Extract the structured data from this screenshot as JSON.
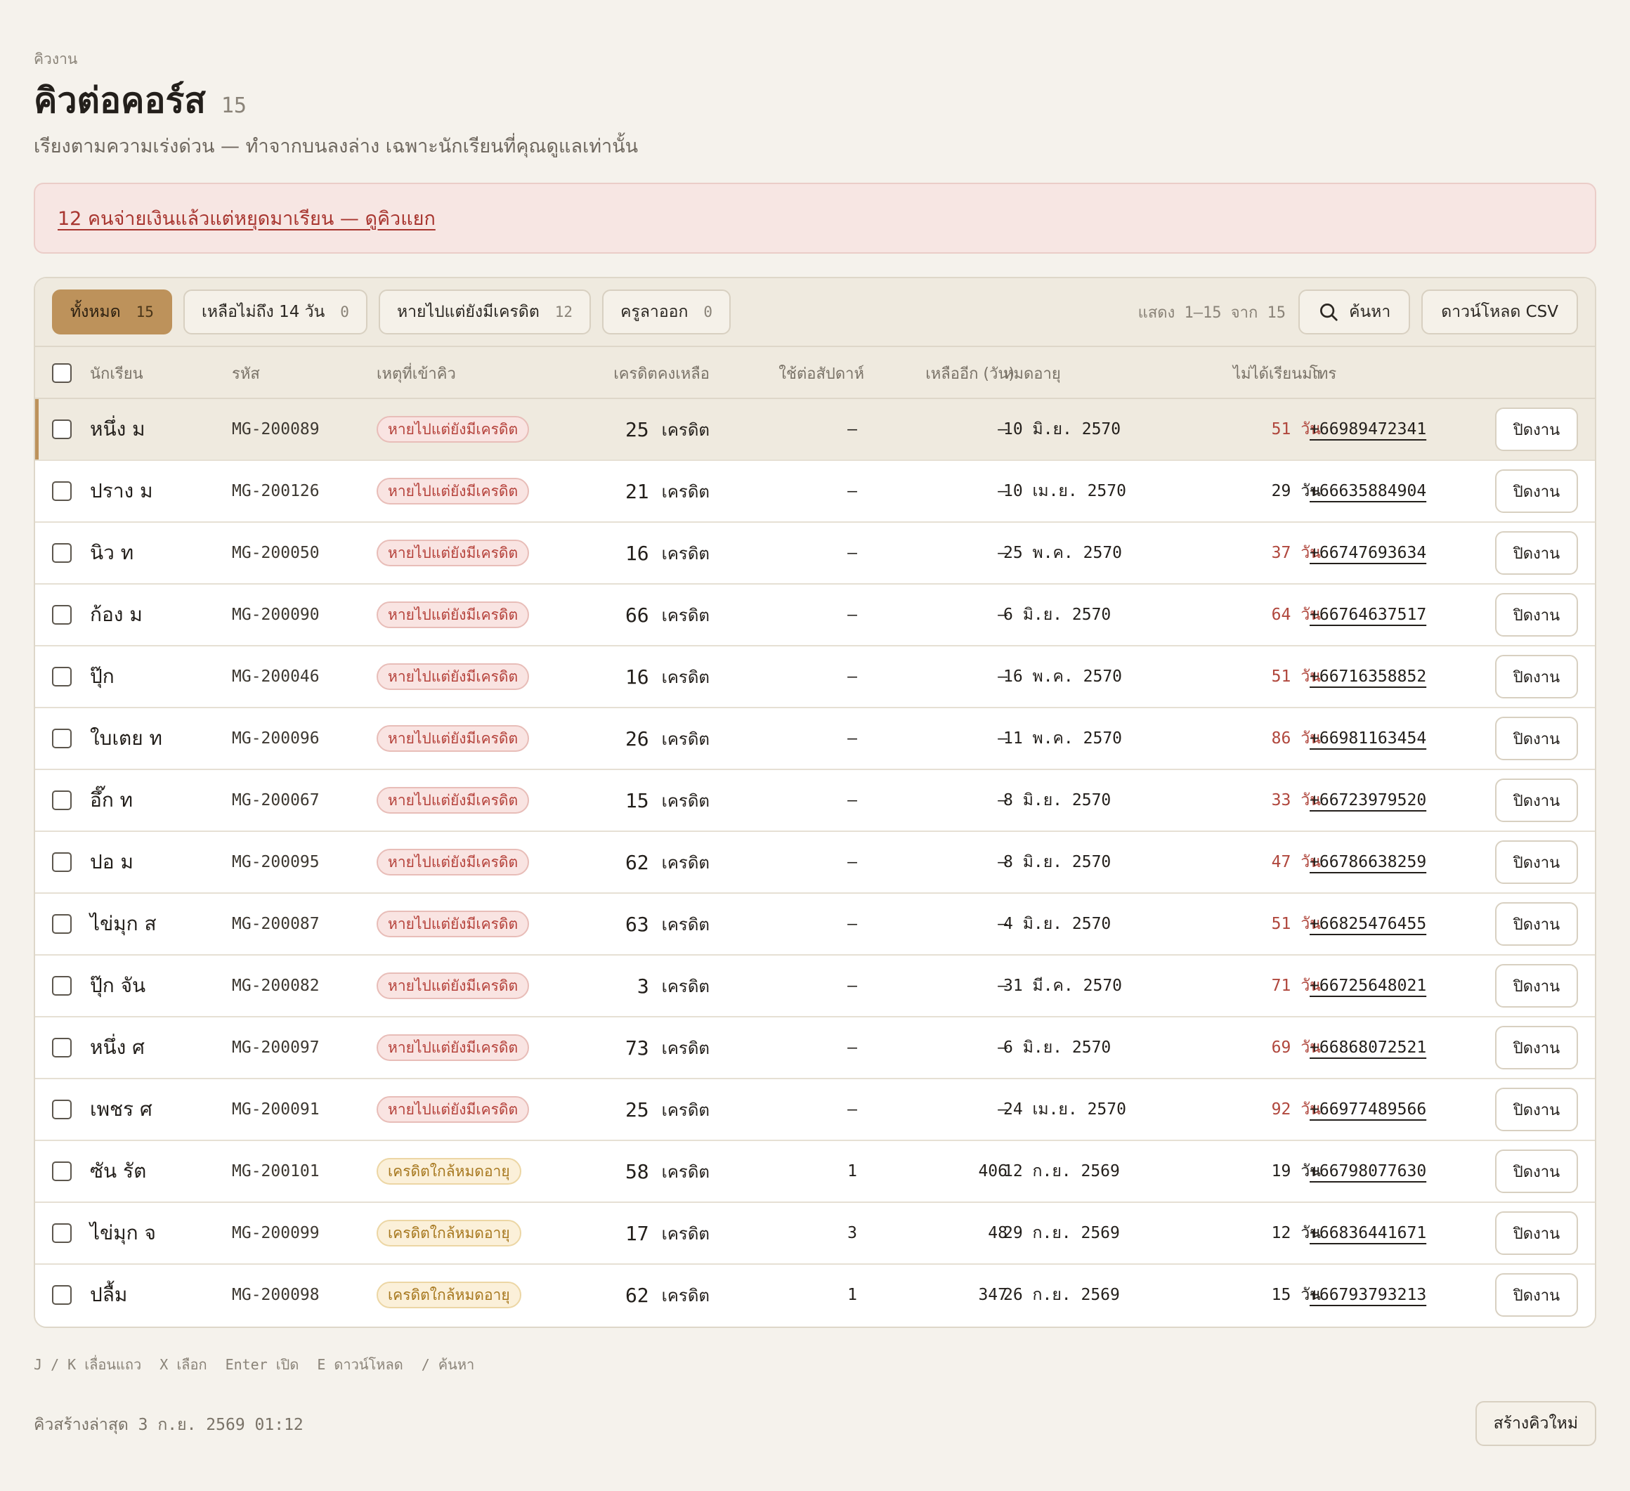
{
  "header": {
    "eyebrow": "คิวงาน",
    "title": "คิวต่อคอร์ส",
    "count": "15",
    "subtitle": "เรียงตามความเร่งด่วน — ทำจากบนลงล่าง เฉพาะนักเรียนที่คุณดูแลเท่านั้น"
  },
  "alert": {
    "text": "12 คนจ่ายเงินแล้วแต่หยุดมาเรียน — ดูคิวแยก"
  },
  "toolbar": {
    "filters": [
      {
        "label": "ทั้งหมด",
        "count": "15"
      },
      {
        "label": "เหลือไม่ถึง 14 วัน",
        "count": "0"
      },
      {
        "label": "หายไปแต่ยังมีเครดิต",
        "count": "12"
      },
      {
        "label": "ครูลาออก",
        "count": "0"
      }
    ],
    "range": "แสดง 1–15 จาก 15",
    "search_label": "ค้นหา",
    "csv_label": "ดาวน์โหลด CSV"
  },
  "columns": {
    "name": "นักเรียน",
    "code": "รหัส",
    "reason": "เหตุที่เข้าคิว",
    "credits": "เครดิตคงเหลือ",
    "weekly": "ใช้ต่อสัปดาห์",
    "days_left": "เหลืออีก (วัน)",
    "expiry": "หมดอายุ",
    "absent": "ไม่ได้เรียนมา",
    "phone": "โทร"
  },
  "labels": {
    "credit_unit": "เครดิต",
    "day_unit": "วัน",
    "close": "ปิดงาน"
  },
  "colors": {
    "accent": "#bd925b",
    "danger": "#b0473d",
    "amber": "#a7781f"
  },
  "rows": [
    {
      "name": "หนึ่ง ม",
      "code": "MG-200089",
      "reason": "หายไปแต่ยังมีเครดิต",
      "tone": "red",
      "credits": "25",
      "weekly": "–",
      "days_left": "–",
      "expiry": "10 มิ.ย. 2570",
      "absent": "51",
      "hot": true,
      "phone": "+66989472341"
    },
    {
      "name": "ปราง ม",
      "code": "MG-200126",
      "reason": "หายไปแต่ยังมีเครดิต",
      "tone": "red",
      "credits": "21",
      "weekly": "–",
      "days_left": "–",
      "expiry": "10 เม.ย. 2570",
      "absent": "29",
      "hot": false,
      "phone": "+66635884904"
    },
    {
      "name": "นิว ท",
      "code": "MG-200050",
      "reason": "หายไปแต่ยังมีเครดิต",
      "tone": "red",
      "credits": "16",
      "weekly": "–",
      "days_left": "–",
      "expiry": "25 พ.ค. 2570",
      "absent": "37",
      "hot": true,
      "phone": "+66747693634"
    },
    {
      "name": "ก้อง ม",
      "code": "MG-200090",
      "reason": "หายไปแต่ยังมีเครดิต",
      "tone": "red",
      "credits": "66",
      "weekly": "–",
      "days_left": "–",
      "expiry": "6 มิ.ย. 2570",
      "absent": "64",
      "hot": true,
      "phone": "+66764637517"
    },
    {
      "name": "ปุ๊ก",
      "code": "MG-200046",
      "reason": "หายไปแต่ยังมีเครดิต",
      "tone": "red",
      "credits": "16",
      "weekly": "–",
      "days_left": "–",
      "expiry": "16 พ.ค. 2570",
      "absent": "51",
      "hot": true,
      "phone": "+66716358852"
    },
    {
      "name": "ใบเตย ท",
      "code": "MG-200096",
      "reason": "หายไปแต่ยังมีเครดิต",
      "tone": "red",
      "credits": "26",
      "weekly": "–",
      "days_left": "–",
      "expiry": "11 พ.ค. 2570",
      "absent": "86",
      "hot": true,
      "phone": "+66981163454"
    },
    {
      "name": "อึ๊ก ท",
      "code": "MG-200067",
      "reason": "หายไปแต่ยังมีเครดิต",
      "tone": "red",
      "credits": "15",
      "weekly": "–",
      "days_left": "–",
      "expiry": "8 มิ.ย. 2570",
      "absent": "33",
      "hot": true,
      "phone": "+66723979520"
    },
    {
      "name": "ปอ ม",
      "code": "MG-200095",
      "reason": "หายไปแต่ยังมีเครดิต",
      "tone": "red",
      "credits": "62",
      "weekly": "–",
      "days_left": "–",
      "expiry": "8 มิ.ย. 2570",
      "absent": "47",
      "hot": true,
      "phone": "+66786638259"
    },
    {
      "name": "ไข่มุก ส",
      "code": "MG-200087",
      "reason": "หายไปแต่ยังมีเครดิต",
      "tone": "red",
      "credits": "63",
      "weekly": "–",
      "days_left": "–",
      "expiry": "4 มิ.ย. 2570",
      "absent": "51",
      "hot": true,
      "phone": "+66825476455"
    },
    {
      "name": "ปุ๊ก จัน",
      "code": "MG-200082",
      "reason": "หายไปแต่ยังมีเครดิต",
      "tone": "red",
      "credits": "3",
      "weekly": "–",
      "days_left": "–",
      "expiry": "31 มี.ค. 2570",
      "absent": "71",
      "hot": true,
      "phone": "+66725648021"
    },
    {
      "name": "หนึ่ง ศ",
      "code": "MG-200097",
      "reason": "หายไปแต่ยังมีเครดิต",
      "tone": "red",
      "credits": "73",
      "weekly": "–",
      "days_left": "–",
      "expiry": "6 มิ.ย. 2570",
      "absent": "69",
      "hot": true,
      "phone": "+66868072521"
    },
    {
      "name": "เพชร ศ",
      "code": "MG-200091",
      "reason": "หายไปแต่ยังมีเครดิต",
      "tone": "red",
      "credits": "25",
      "weekly": "–",
      "days_left": "–",
      "expiry": "24 เม.ย. 2570",
      "absent": "92",
      "hot": true,
      "phone": "+66977489566"
    },
    {
      "name": "ซัน รัต",
      "code": "MG-200101",
      "reason": "เครดิตใกล้หมดอายุ",
      "tone": "amber",
      "credits": "58",
      "weekly": "1",
      "days_left": "406",
      "expiry": "12 ก.ย. 2569",
      "absent": "19",
      "hot": false,
      "phone": "+66798077630"
    },
    {
      "name": "ไข่มุก จ",
      "code": "MG-200099",
      "reason": "เครดิตใกล้หมดอายุ",
      "tone": "amber",
      "credits": "17",
      "weekly": "3",
      "days_left": "48",
      "expiry": "29 ก.ย. 2569",
      "absent": "12",
      "hot": false,
      "phone": "+66836441671"
    },
    {
      "name": "ปลื้ม",
      "code": "MG-200098",
      "reason": "เครดิตใกล้หมดอายุ",
      "tone": "amber",
      "credits": "62",
      "weekly": "1",
      "days_left": "347",
      "expiry": "26 ก.ย. 2569",
      "absent": "15",
      "hot": false,
      "phone": "+66793793213"
    }
  ],
  "shortcuts": [
    "J / K เลื่อนแถว",
    "X เลือก",
    "Enter เปิด",
    "E ดาวน์โหลด",
    "/ ค้นหา"
  ],
  "footer": {
    "note": "คิวสร้างล่าสุด 3 ก.ย. 2569 01:12",
    "new_queue_label": "สร้างคิวใหม่"
  }
}
